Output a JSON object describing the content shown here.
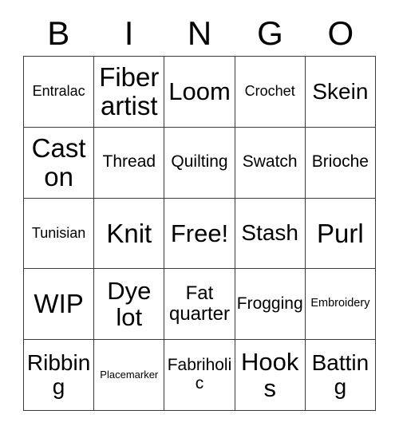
{
  "card": {
    "title": "BINGO",
    "header": {
      "letters": [
        "B",
        "I",
        "N",
        "G",
        "O"
      ]
    },
    "colors": {
      "background": "#ffffff",
      "text": "#000000",
      "grid_line": "#3a3a3a"
    },
    "free_space_label": "Free!",
    "rows": [
      [
        {
          "label": "Entralac",
          "size": "fs-md"
        },
        {
          "label": "Fiber artist",
          "size": "fs-4xl"
        },
        {
          "label": "Loom",
          "size": "fs-3xl"
        },
        {
          "label": "Crochet",
          "size": "fs-md"
        },
        {
          "label": "Skein",
          "size": "fs-2xl"
        }
      ],
      [
        {
          "label": "Cast on",
          "size": "fs-4xl"
        },
        {
          "label": "Thread",
          "size": "fs-lg"
        },
        {
          "label": "Quilting",
          "size": "fs-lg"
        },
        {
          "label": "Swatch",
          "size": "fs-lg"
        },
        {
          "label": "Brioche",
          "size": "fs-lg"
        }
      ],
      [
        {
          "label": "Tunisian",
          "size": "fs-md"
        },
        {
          "label": "Knit",
          "size": "fs-4xl"
        },
        {
          "label": "Free!",
          "size": "fs-3xl"
        },
        {
          "label": "Stash",
          "size": "fs-2xl"
        },
        {
          "label": "Purl",
          "size": "fs-4xl"
        }
      ],
      [
        {
          "label": "WIP",
          "size": "fs-4xl"
        },
        {
          "label": "Dye lot",
          "size": "fs-3xl"
        },
        {
          "label": "Fat quarter",
          "size": "fs-xl"
        },
        {
          "label": "Frogging",
          "size": "fs-lg"
        },
        {
          "label": "Embroidery",
          "size": "fs-sm"
        }
      ],
      [
        {
          "label": "Ribbing",
          "size": "fs-2xl"
        },
        {
          "label": "Placemarker",
          "size": "fs-xs"
        },
        {
          "label": "Fabriholic",
          "size": "fs-lg"
        },
        {
          "label": "Hooks",
          "size": "fs-3xl"
        },
        {
          "label": "Batting",
          "size": "fs-2xl"
        }
      ]
    ]
  }
}
